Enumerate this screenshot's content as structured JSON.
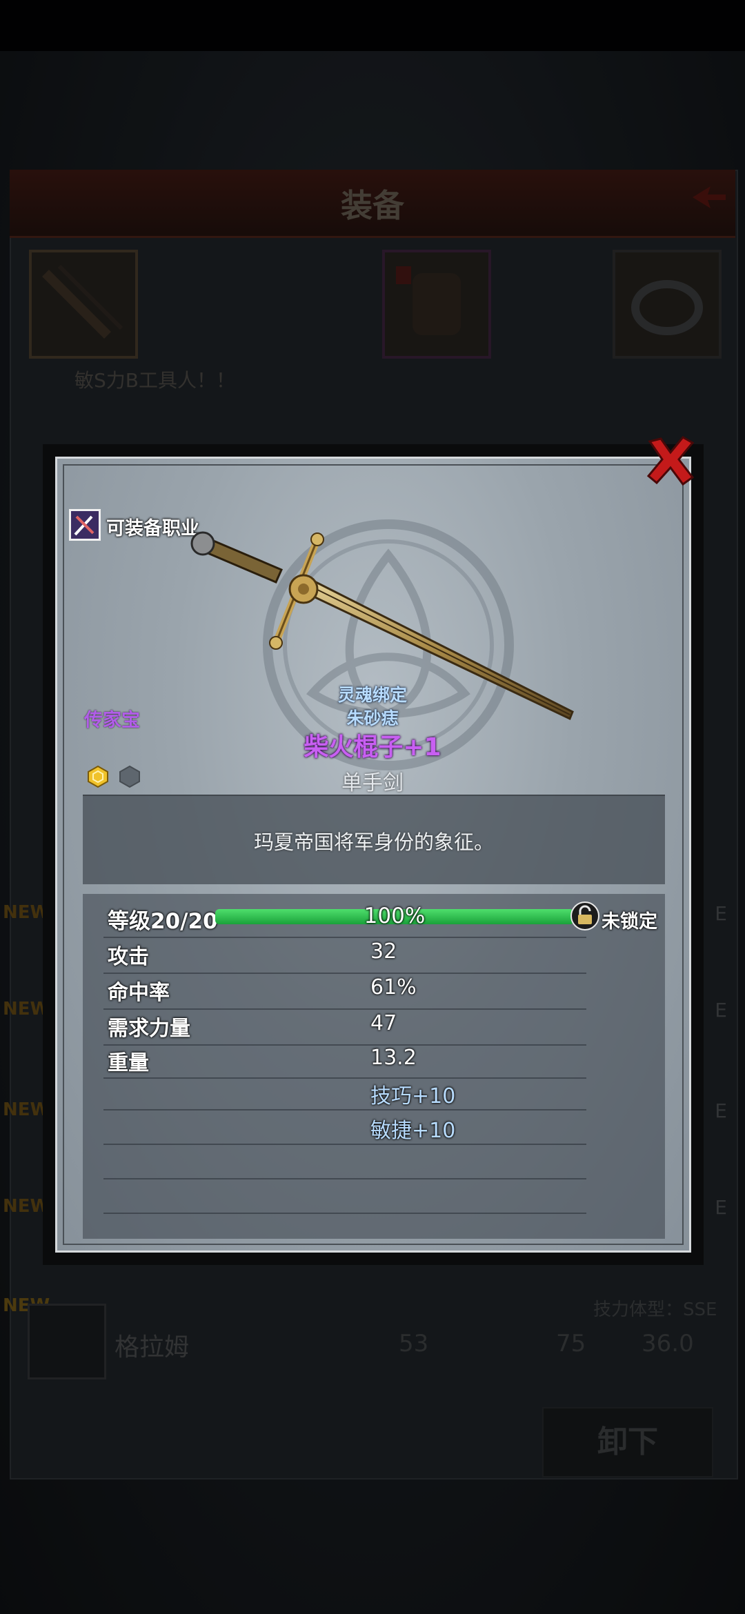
{
  "background": {
    "screen_title": "装备",
    "team_label": "敏S力B工具人！！",
    "new_badge": "NEW",
    "row": {
      "name": "格拉姆",
      "value_1": "53",
      "value_2": "75",
      "value_3": "36.0",
      "tag": "技力体型：SSE"
    },
    "unequip_button": "卸下",
    "edge_letter": "E"
  },
  "item": {
    "job_label": "可装备职业",
    "rarity": "传家宝",
    "bind_label": "灵魂绑定",
    "sub_name": "朱砂痣",
    "name": "柴火棍子+1",
    "type": "单手剑",
    "description": "玛夏帝国将军身份的象征。",
    "level": {
      "label": "等级20/20",
      "progress_percent": 100,
      "progress_text": "100%",
      "lock_label": "未锁定"
    },
    "stats": [
      {
        "label": "攻击",
        "value": "32"
      },
      {
        "label": "命中率",
        "value": "61%"
      },
      {
        "label": "需求力量",
        "value": "47"
      },
      {
        "label": "重量",
        "value": "13.2"
      }
    ],
    "bonuses": [
      "技巧+10",
      "敏捷+10"
    ],
    "sockets": [
      "filled",
      "empty"
    ]
  },
  "colors": {
    "rarity": "#b15de8",
    "item_name": "#c85ff2",
    "bind_text": "#b8dcff",
    "level_bar": "#2ec24e",
    "close_x": "#c41a1a"
  },
  "icons": {
    "job": "crossed-swords-icon",
    "close": "close-x-icon",
    "lock": "padlock-icon",
    "socket_filled": "hex-gem-icon",
    "socket_empty": "hex-socket-icon"
  }
}
